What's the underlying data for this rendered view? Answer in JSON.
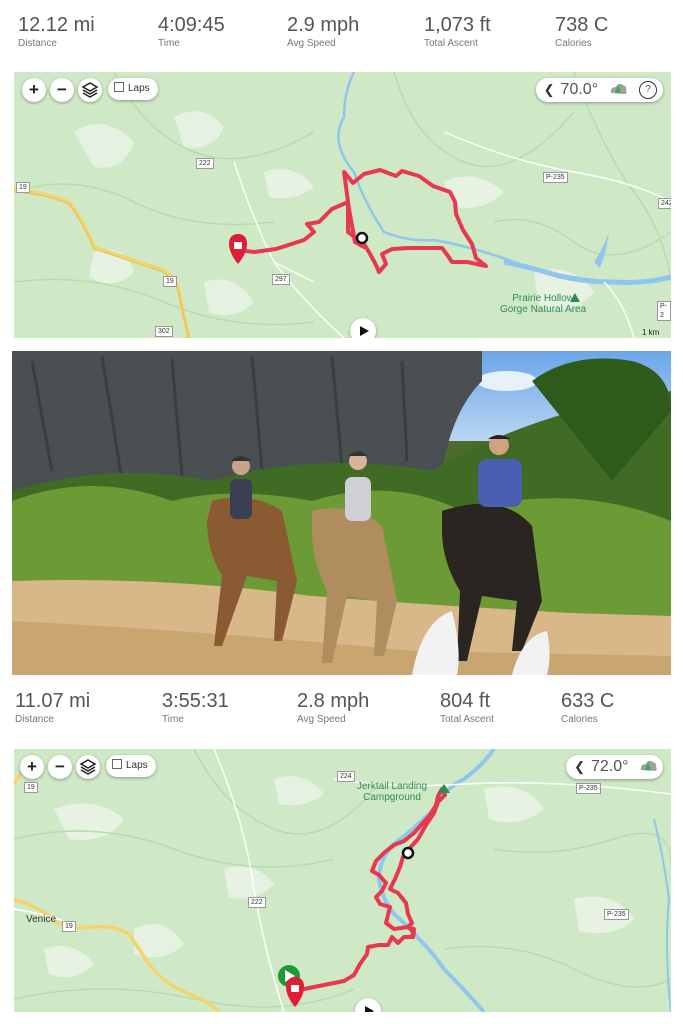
{
  "ride1": {
    "stats": [
      {
        "value": "12.12 mi",
        "label": "Distance"
      },
      {
        "value": "4:09:45",
        "label": "Time"
      },
      {
        "value": "2.9 mph",
        "label": "Avg Speed"
      },
      {
        "value": "1,073 ft",
        "label": "Total Ascent"
      },
      {
        "value": "738 C",
        "label": "Calories"
      }
    ],
    "map": {
      "zoom_in": "+",
      "zoom_out": "−",
      "laps_label": "Laps",
      "temperature": "70.0°",
      "help": "?",
      "labels": {
        "poi": "Prairie Hollow\nGorge Natural Area",
        "scale": "1 km"
      },
      "roads": [
        "19",
        "222",
        "19",
        "302",
        "297",
        "P-235",
        "242",
        "P-2"
      ]
    }
  },
  "photo": {
    "alt": "Three riders on horseback on a sandy trail below a rock cliff",
    "icon": "photo-icon"
  },
  "ride2": {
    "stats": [
      {
        "value": "11.07 mi",
        "label": "Distance"
      },
      {
        "value": "3:55:31",
        "label": "Time"
      },
      {
        "value": "2.8 mph",
        "label": "Avg Speed"
      },
      {
        "value": "804 ft",
        "label": "Total Ascent"
      },
      {
        "value": "633 C",
        "label": "Calories"
      }
    ],
    "map": {
      "zoom_in": "+",
      "zoom_out": "−",
      "laps_label": "Laps",
      "temperature": "72.0°",
      "labels": {
        "poi": "Jerktail Landing\nCampground",
        "town": "Venice"
      },
      "roads": [
        "19",
        "224",
        "P-235",
        "222",
        "19",
        "P-235"
      ]
    }
  },
  "colors": {
    "route": "#e8384f",
    "map_bg": "#cfe9c6",
    "water": "#aadaff",
    "road_yellow": "#f5d36b",
    "poi_green": "#2e8b57"
  }
}
